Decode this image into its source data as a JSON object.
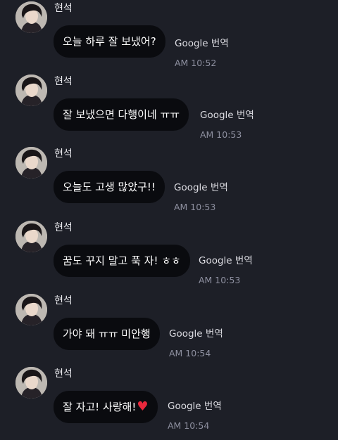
{
  "messages": [
    {
      "sender": "현석",
      "text": "오늘 하루 잘 보냈어?",
      "translate": "Google 번역",
      "time": "AM 10:52"
    },
    {
      "sender": "현석",
      "text": "잘 보냈으면 다행이네 ㅠㅠ",
      "translate": "Google 번역",
      "time": "AM 10:53"
    },
    {
      "sender": "현석",
      "text": "오늘도 고생 많았구!!",
      "translate": "Google 번역",
      "time": "AM 10:53"
    },
    {
      "sender": "현석",
      "text": "꿈도 꾸지 말고 푹 자! ㅎㅎ",
      "translate": "Google 번역",
      "time": "AM 10:53"
    },
    {
      "sender": "현석",
      "text": "가야 돼 ㅠㅠ 미안행",
      "translate": "Google 번역",
      "time": "AM 10:54"
    },
    {
      "sender": "현석",
      "text": "잘 자고! 사랑해!",
      "emoji": "red-heart",
      "translate": "Google 번역",
      "time": "AM 10:54"
    }
  ],
  "colors": {
    "background": "#1d1f27",
    "bubble": "#0a0b0f",
    "timestamp": "#8e90a0",
    "heart": "#e8283c"
  }
}
